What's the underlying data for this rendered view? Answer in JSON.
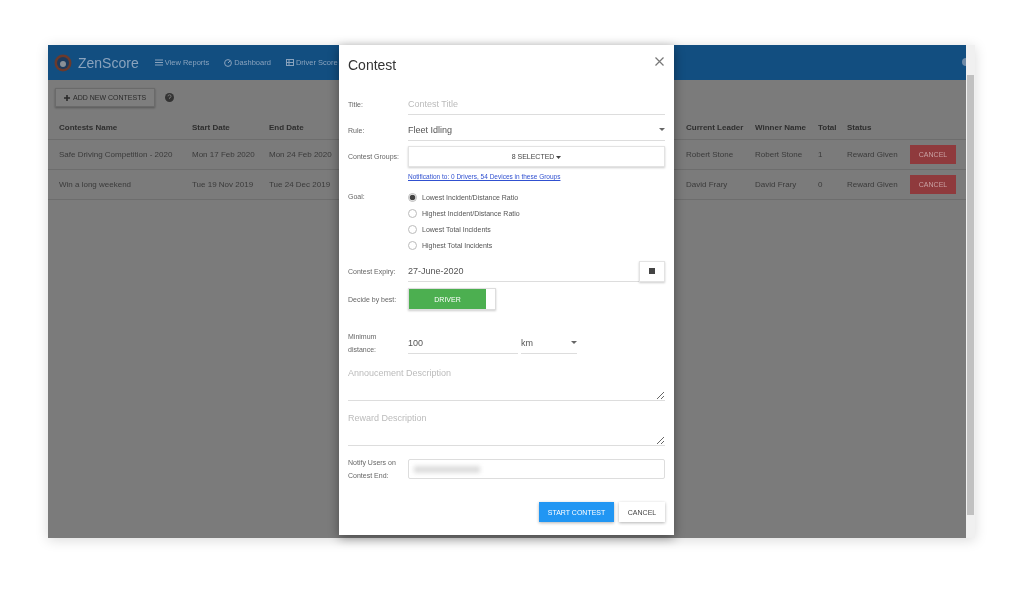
{
  "app": {
    "brand": "ZenScore",
    "nav": [
      {
        "label": "View Reports",
        "kind": "list"
      },
      {
        "label": "Dashboard",
        "kind": "gauge"
      },
      {
        "label": "Driver Score",
        "kind": "table"
      }
    ]
  },
  "toolbar": {
    "add_button": "ADD NEW CONTESTS"
  },
  "table": {
    "columns": [
      "Contests Name",
      "Start Date",
      "End Date",
      "Current Leader",
      "Winner Name",
      "Total",
      "Status"
    ],
    "rows": [
      {
        "cells": [
          "Safe Driving Competition - 2020",
          "Mon 17 Feb 2020",
          "Mon 24 Feb 2020",
          "Robert Stone",
          "Robert Stone",
          "1",
          "Reward Given"
        ],
        "action": "CANCEL"
      },
      {
        "cells": [
          "Win a long weekend",
          "Tue 19 Nov 2019",
          "Tue 24 Dec 2019",
          "David Frary",
          "David Frary",
          "0",
          "Reward Given"
        ],
        "action": "CANCEL"
      }
    ]
  },
  "modal": {
    "title": "Contest",
    "title_label": "Title:",
    "title_placeholder": "Contest Title",
    "rule_label": "Rule:",
    "rule_value": "Fleet Idling",
    "groups_label": "Contest Groups:",
    "groups_value": "8 SELECTED",
    "notification_link": "Notification to: 0 Drivers, 54 Devices in these Groups",
    "goal_label": "Goal:",
    "goals": [
      {
        "label": "Lowest Incident/Distance Ratio",
        "selected": true
      },
      {
        "label": "Highest Incident/Distance Ratio",
        "selected": false
      },
      {
        "label": "Lowest Total Incidents",
        "selected": false
      },
      {
        "label": "Highest Total Incidents",
        "selected": false
      }
    ],
    "expiry_label": "Contest Expiry:",
    "expiry_value": "27-June-2020",
    "decide_label": "Decide by best:",
    "decide_toggle": {
      "label": "DRIVER",
      "on": true
    },
    "distance_label": "Minimum distance:",
    "distance_value": "100",
    "distance_unit": "km",
    "announcement_placeholder": "Annoucement Description",
    "reward_placeholder": "Reward Description",
    "notify_label": "Notify Users on Contest End:",
    "buttons": [
      {
        "label": "START CONTEST",
        "kind": "primary"
      },
      {
        "label": "CANCEL",
        "kind": "default"
      }
    ]
  }
}
